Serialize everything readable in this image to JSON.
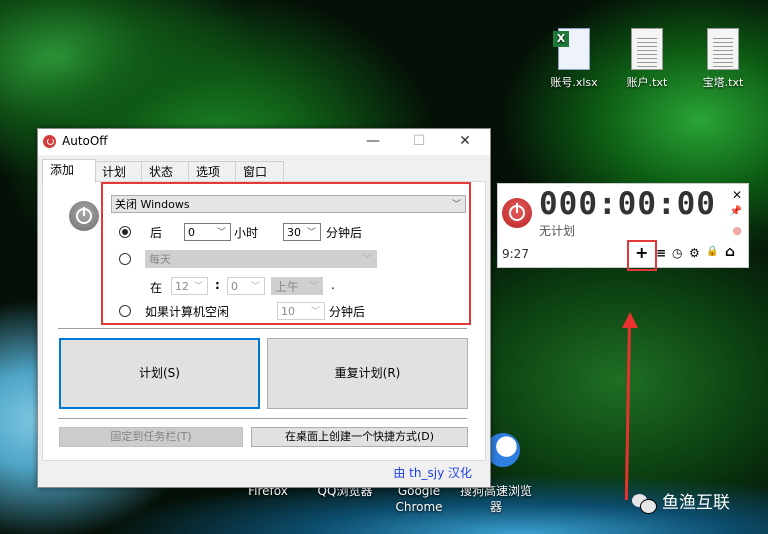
{
  "desktop": {
    "icons": [
      {
        "label": "账号.xlsx",
        "type": "excel"
      },
      {
        "label": "账户.txt",
        "type": "text"
      },
      {
        "label": "宝塔.txt",
        "type": "text"
      }
    ],
    "shortcuts": [
      {
        "label": "Firefox"
      },
      {
        "label": "QQ浏览器"
      },
      {
        "label": "Google Chrome"
      },
      {
        "label": "搜狗高速浏览器"
      }
    ],
    "watermark": "鱼渔互联"
  },
  "window": {
    "title": "AutoOff",
    "controls": {
      "minimize": "—",
      "maximize": "☐",
      "close": "✕"
    },
    "tabs": [
      {
        "label": "添加",
        "active": true
      },
      {
        "label": "计划",
        "active": false
      },
      {
        "label": "状态",
        "active": false
      },
      {
        "label": "选项",
        "active": false
      },
      {
        "label": "窗口",
        "active": false
      }
    ],
    "action_select": "关闭 Windows",
    "option_after": {
      "label": "后",
      "selected": true,
      "hours": "0",
      "hours_unit": "小时",
      "minutes": "30",
      "minutes_unit": "分钟后"
    },
    "option_schedule": {
      "selected": false,
      "frequency": "每天",
      "at_label": "在",
      "hour": "12",
      "colon": ":",
      "minute": "0",
      "ampm": "上午",
      "period": "."
    },
    "option_idle": {
      "label": "如果计算机空闲",
      "selected": false,
      "minutes": "10",
      "unit": "分钟后"
    },
    "buttons": {
      "schedule": "计划(S)",
      "repeat_schedule": "重复计划(R)",
      "pin_taskbar": "固定到任务栏(T)",
      "desktop_shortcut": "在桌面上创建一个快捷方式(D)"
    },
    "credit": "由 th_sjy 汉化"
  },
  "widget": {
    "countdown": "000:00:00",
    "status": "无计划",
    "time": "9:27",
    "side_icons": {
      "close": "✕",
      "pin": "📌",
      "drop": "●"
    },
    "tools": {
      "add": "+",
      "list": "≡",
      "clock": "◷",
      "settings": "⚙",
      "lock": "🔒",
      "home": "⌂"
    }
  },
  "colors": {
    "highlight_red": "#e23a3a",
    "focus_blue": "#0078d7",
    "credit_blue": "#1a3ee0"
  }
}
